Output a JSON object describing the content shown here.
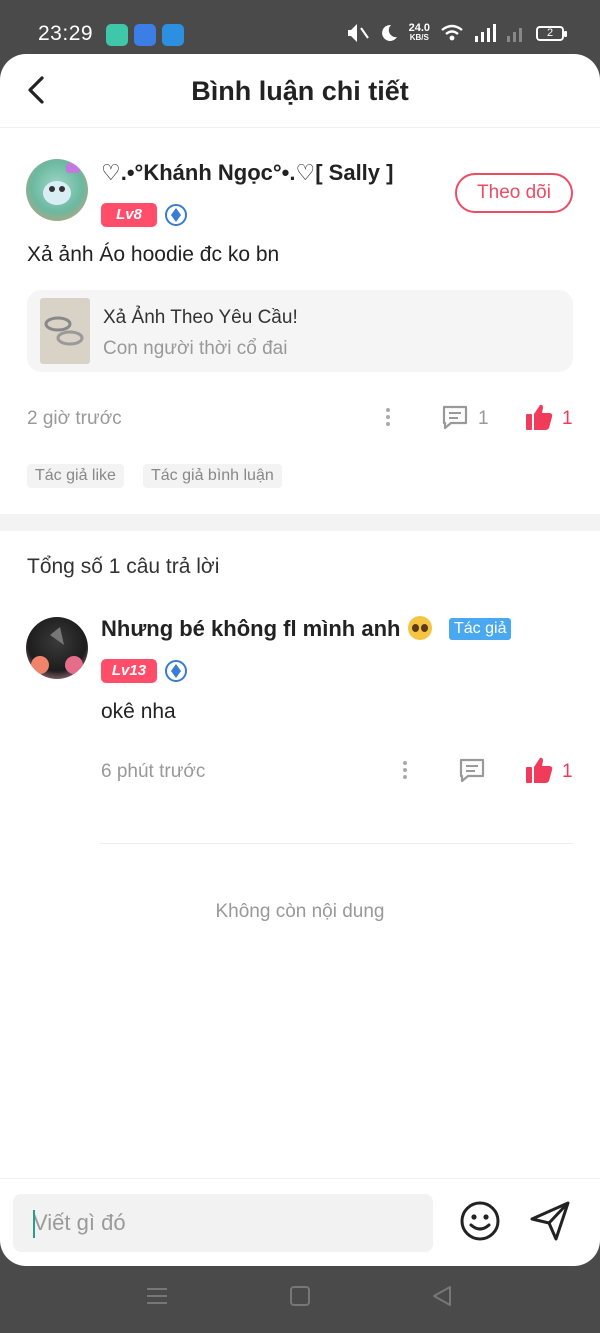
{
  "status_bar": {
    "time": "23:29",
    "speed_value": "24.0",
    "speed_unit": "KB/S",
    "battery": "2"
  },
  "header": {
    "title": "Bình luận chi tiết",
    "back_icon": "chevron-left-icon"
  },
  "post": {
    "author_name": "♡.•°Khánh Ngọc°•.♡[ Sally ]",
    "level": "Lv8",
    "follow_label": "Theo dõi",
    "text": "Xả ảnh Áo hoodie đc ko bn",
    "reference": {
      "title": "Xả Ảnh Theo Yêu Cầu!",
      "subtitle": "Con người thời cổ đai"
    },
    "time": "2 giờ trước",
    "comment_count": "1",
    "like_count": "1",
    "tags": [
      "Tác giả like",
      "Tác giả bình luận"
    ]
  },
  "replies": {
    "total_label": "Tổng số 1 câu trả lời",
    "items": [
      {
        "author_name": "Nhưng bé không fl mình anh",
        "author_tag": "Tác giả",
        "level": "Lv13",
        "text": "okê nha",
        "time": "6 phút trước",
        "like_count": "1"
      }
    ]
  },
  "end_message": "Không còn nội dung",
  "composer": {
    "placeholder": "Viết gì đó"
  },
  "colors": {
    "accent": "#ef4b64",
    "level_badge": "#ff4d6a",
    "author_tag": "#4aa8f0",
    "like": "#f03c5a"
  },
  "icons": [
    "chevron-left-icon",
    "verified-icon",
    "more-vertical-icon",
    "comment-icon",
    "thumbs-up-icon",
    "smiley-icon",
    "send-icon",
    "menu-icon",
    "home-icon",
    "back-triangle-icon"
  ]
}
